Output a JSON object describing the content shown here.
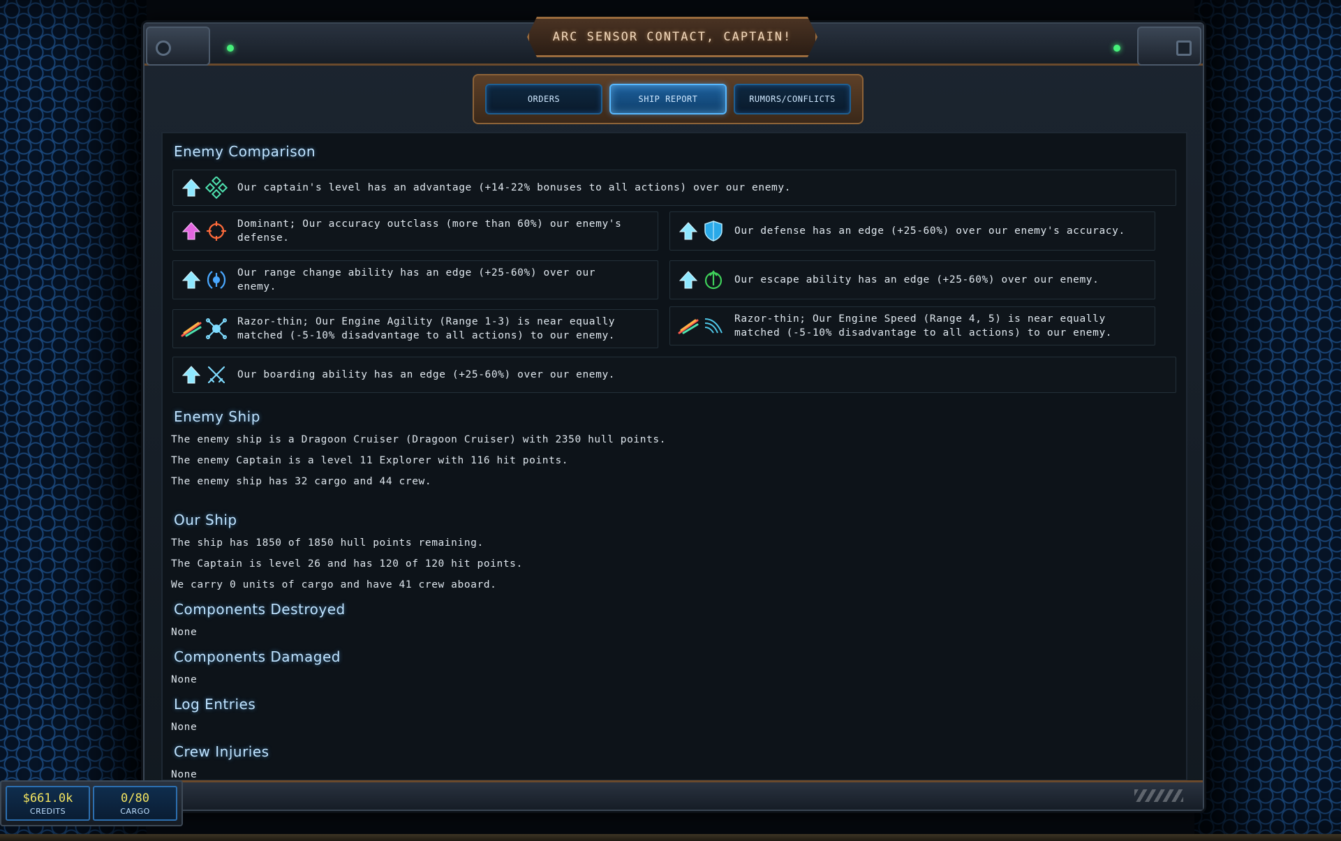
{
  "window": {
    "title": "ARC SENSOR CONTACT, CAPTAIN!"
  },
  "tabs": [
    {
      "label": "ORDERS",
      "active": false
    },
    {
      "label": "SHIP REPORT",
      "active": true
    },
    {
      "label": "RUMORS/CONFLICTS",
      "active": false
    }
  ],
  "comparison": {
    "title": "Enemy Comparison",
    "items": [
      {
        "status_icon": "arrow-up-cyan-icon",
        "icon": "captain-level-icon",
        "text": "Our captain's level has an advantage (+14-22% bonuses to all actions) over our enemy."
      },
      {
        "status_icon": "arrow-up-magenta-icon",
        "icon": "crosshair-icon",
        "text": "Dominant; Our accuracy outclass (more than 60%)  our enemy's defense."
      },
      {
        "status_icon": "arrow-up-cyan-icon",
        "icon": "shield-icon",
        "text": "Our defense has an edge (+25-60%) over our enemy's accuracy."
      },
      {
        "status_icon": "arrow-up-cyan-icon",
        "icon": "range-icon",
        "text": "Our range change ability has an edge (+25-60%) over our enemy."
      },
      {
        "status_icon": "arrow-up-cyan-icon",
        "icon": "escape-icon",
        "text": "Our escape ability has an edge (+25-60%) over our enemy."
      },
      {
        "status_icon": "razor-thin-icon",
        "icon": "engine-agility-icon",
        "text": "Razor-thin; Our Engine Agility (Range 1-3) is near equally matched (-5-10% disadvantage to all actions) to our enemy."
      },
      {
        "status_icon": "razor-thin-icon",
        "icon": "engine-speed-icon",
        "text": "Razor-thin; Our Engine Speed (Range 4, 5) is near equally matched (-5-10% disadvantage to all actions) to our enemy."
      },
      {
        "status_icon": "arrow-up-cyan-icon",
        "icon": "boarding-swords-icon",
        "text": "Our boarding ability has an edge (+25-60%) over our enemy."
      }
    ]
  },
  "enemy_ship": {
    "title": "Enemy Ship",
    "lines": [
      "The enemy ship is a Dragoon Cruiser (Dragoon Cruiser) with 2350 hull points.",
      "The enemy Captain is a level 11 Explorer with 116 hit points.",
      "The enemy ship has 32 cargo and 44 crew."
    ]
  },
  "our_ship": {
    "title": "Our Ship",
    "lines": [
      "The ship has 1850 of 1850 hull points remaining.",
      "The Captain is level 26 and has 120 of 120 hit points.",
      "We carry 0 units of cargo and have 41 crew aboard."
    ]
  },
  "components_destroyed": {
    "title": "Components Destroyed",
    "value": "None"
  },
  "components_damaged": {
    "title": "Components Damaged",
    "value": "None"
  },
  "log_entries": {
    "title": "Log Entries",
    "value": "None"
  },
  "crew_injuries": {
    "title": "Crew Injuries",
    "value": "None"
  },
  "status": {
    "credits": {
      "value": "$661.0k",
      "label": "CREDITS"
    },
    "cargo": {
      "value": "0/80",
      "label": "CARGO"
    }
  },
  "colors": {
    "accent_cyan": "#7fe0ff",
    "accent_magenta": "#e05adf",
    "title_glow": "#bfe3ff",
    "frame_bronze": "#9a6b3d",
    "status_value": "#f4e560"
  }
}
